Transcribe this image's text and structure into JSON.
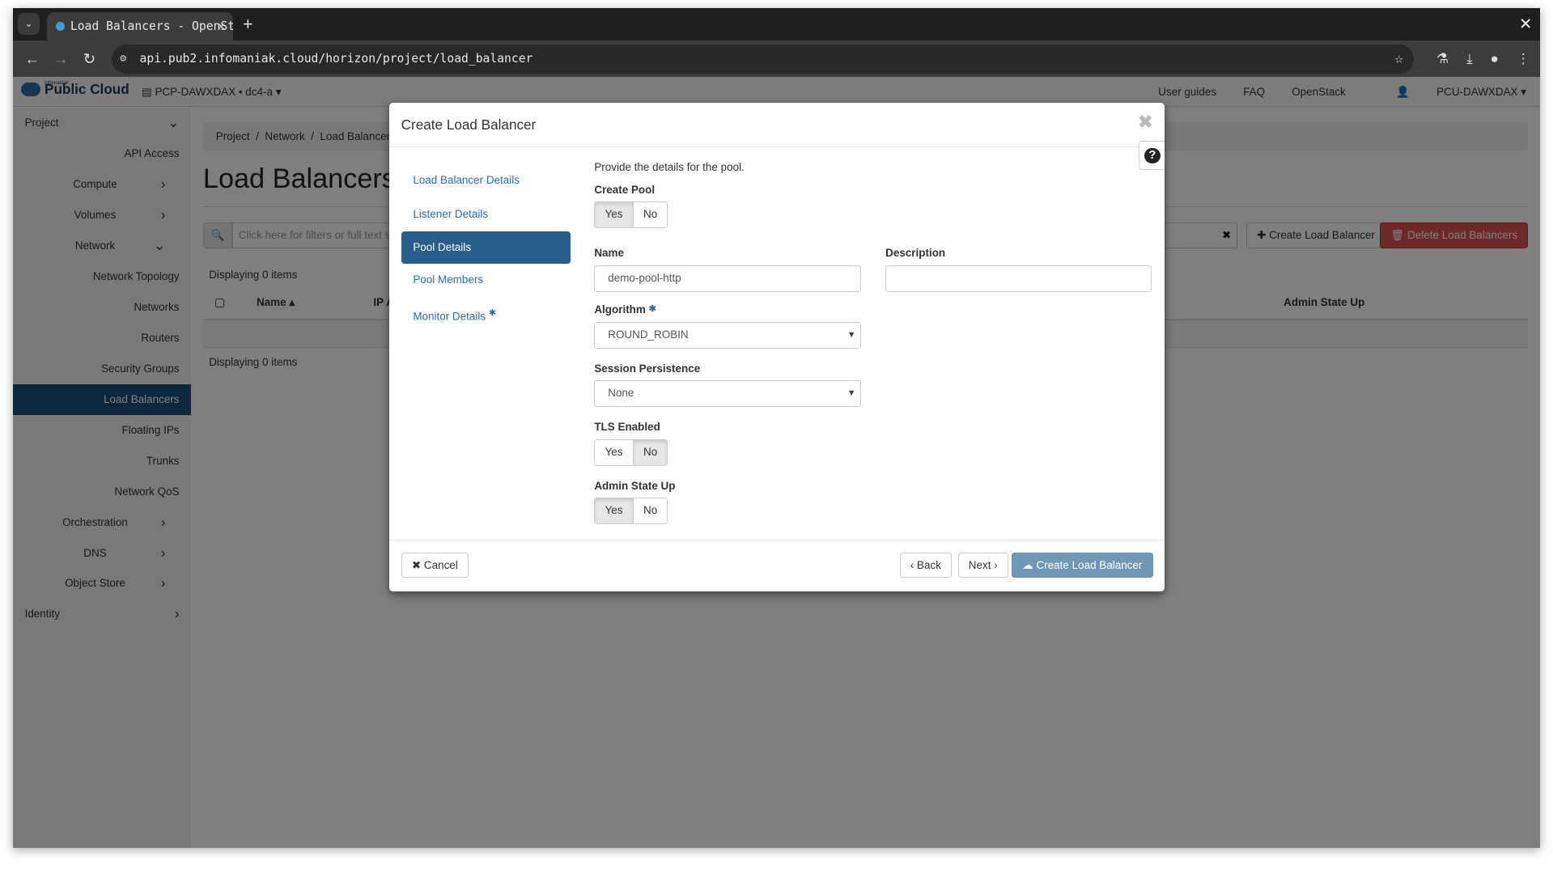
{
  "browser": {
    "tab_title": "Load Balancers - OpenStack",
    "url": "api.pub2.infomaniak.cloud/horizon/project/load_balancer"
  },
  "topnav": {
    "brand_small": "Infomaniak",
    "brand": "Public Cloud",
    "project": "PCP-DAWXDAX • dc4-a ▾",
    "links": [
      "User guides",
      "FAQ",
      "OpenStack"
    ],
    "user": "PCU-DAWXDAX ▾"
  },
  "sidebar": {
    "items": [
      {
        "label": "Project",
        "level": 0,
        "chevron": "down"
      },
      {
        "label": "API Access",
        "level": 2
      },
      {
        "label": "Compute",
        "level": 1,
        "chevron": "right"
      },
      {
        "label": "Volumes",
        "level": 1,
        "chevron": "right"
      },
      {
        "label": "Network",
        "level": 1,
        "chevron": "down"
      },
      {
        "label": "Network Topology",
        "level": 2
      },
      {
        "label": "Networks",
        "level": 2
      },
      {
        "label": "Routers",
        "level": 2
      },
      {
        "label": "Security Groups",
        "level": 2
      },
      {
        "label": "Load Balancers",
        "level": 2,
        "active": true
      },
      {
        "label": "Floating IPs",
        "level": 2
      },
      {
        "label": "Trunks",
        "level": 2
      },
      {
        "label": "Network QoS",
        "level": 2
      },
      {
        "label": "Orchestration",
        "level": 1,
        "chevron": "right"
      },
      {
        "label": "DNS",
        "level": 1,
        "chevron": "right"
      },
      {
        "label": "Object Store",
        "level": 1,
        "chevron": "right"
      },
      {
        "label": "Identity",
        "level": 0,
        "chevron": "right"
      }
    ]
  },
  "main": {
    "breadcrumb": "Project  /  Network  /  Load Balancers",
    "title": "Load Balancers",
    "filter_placeholder": "Click here for filters or full text search.",
    "create_btn": "Create Load Balancer",
    "delete_btn": "Delete Load Balancers",
    "displaying": "Displaying 0 items",
    "columns": [
      "Name",
      "IP Address",
      "Admin State Up"
    ]
  },
  "modal": {
    "title": "Create Load Balancer",
    "steps": [
      "Load Balancer Details",
      "Listener Details",
      "Pool Details",
      "Pool Members",
      "Monitor Details"
    ],
    "active_step": "Pool Details",
    "intro": "Provide the details for the pool.",
    "create_pool": {
      "label": "Create Pool",
      "options": [
        "Yes",
        "No"
      ],
      "selected": "Yes"
    },
    "name": {
      "label": "Name",
      "value": "demo-pool-http"
    },
    "description": {
      "label": "Description",
      "value": ""
    },
    "algorithm": {
      "label": "Algorithm",
      "value": "ROUND_ROBIN"
    },
    "session_persistence": {
      "label": "Session Persistence",
      "value": "None"
    },
    "tls_enabled": {
      "label": "TLS Enabled",
      "options": [
        "Yes",
        "No"
      ],
      "selected": "No"
    },
    "admin_state_up": {
      "label": "Admin State Up",
      "options": [
        "Yes",
        "No"
      ],
      "selected": "Yes"
    },
    "buttons": {
      "cancel": "Cancel",
      "back": "Back",
      "next": "Next",
      "create": "Create Load Balancer"
    }
  },
  "colors": {
    "primary": "#285e8a",
    "danger": "#d9534f",
    "sidebar_active": "#1b4f78"
  }
}
